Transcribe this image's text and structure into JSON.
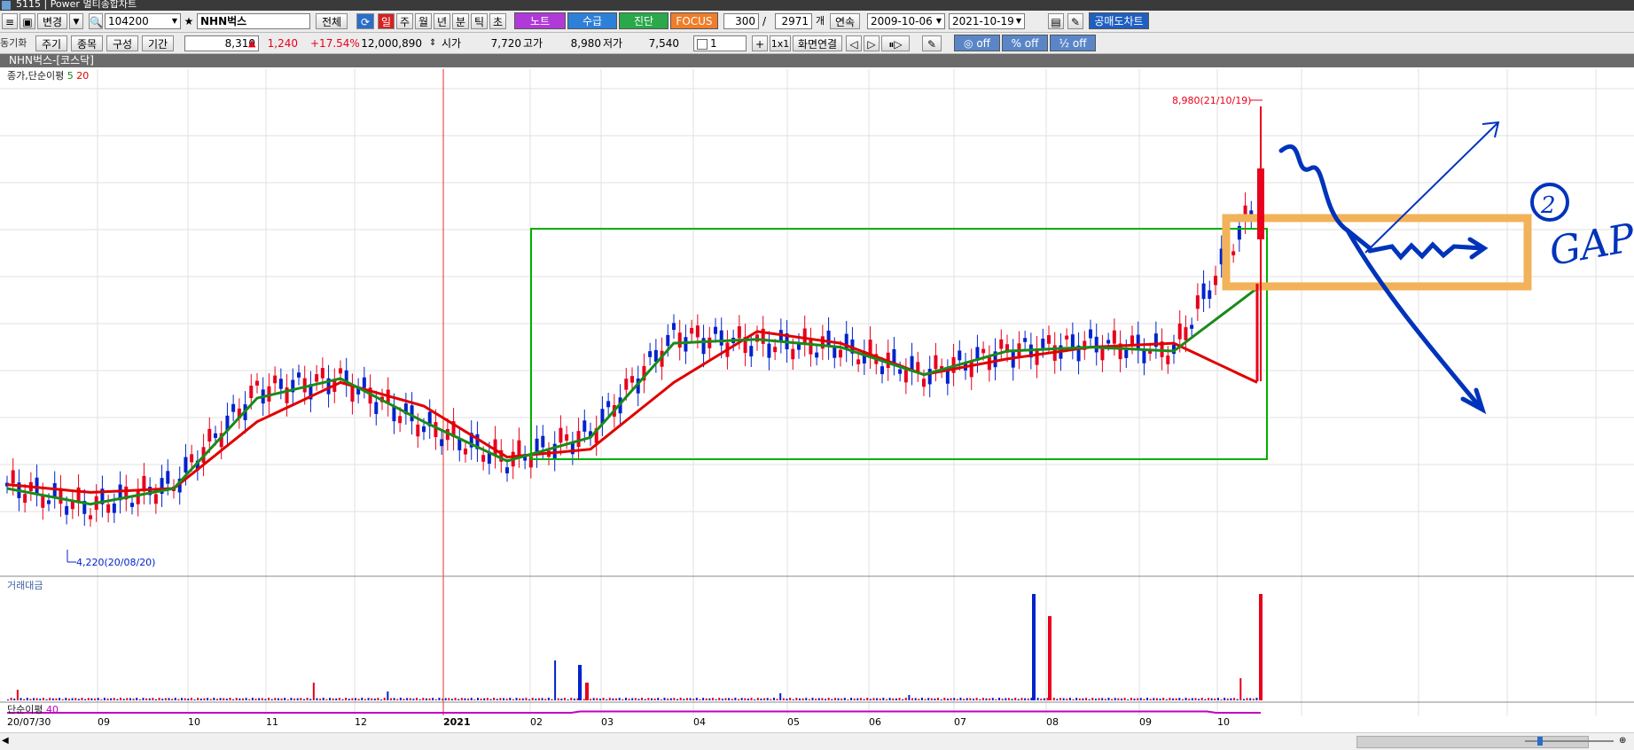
{
  "window": {
    "title": "5115 | Power 멀티종합차트"
  },
  "toolbar1": {
    "change_label": "변경",
    "code": "104200",
    "name": "NHN벅스",
    "all_label": "전체",
    "periods": [
      "일",
      "주",
      "월",
      "년",
      "분",
      "틱",
      "초"
    ],
    "note_label": "노트",
    "supply_label": "수급",
    "diag_label": "진단",
    "focus_label": "FOCUS",
    "count": "300",
    "total": "2971",
    "unit_label": "개",
    "continuous_label": "연속",
    "start_date": "2009-10-06",
    "end_date": "2021-10-19",
    "short_sell_label": "공매도차트"
  },
  "toolbar2": {
    "sync_label": "동기화",
    "period_label": "주기",
    "item_label": "종목",
    "compose_label": "구성",
    "range_label": "기간",
    "price": "8,310",
    "change": "1,240",
    "change_pct": "+17.54%",
    "volume": "12,000,890",
    "open_label": "시가",
    "open": "7,720",
    "high_label": "고가",
    "high": "8,980",
    "low_label": "저가",
    "low": "7,540",
    "spin_value": "1",
    "ratio_label": "1x1",
    "link_label": "화면연결",
    "off1": "off",
    "off2": "off",
    "off3": "off"
  },
  "chart_header": "NHN벅스-[코스닥]",
  "price_panel": {
    "label": "종가,단순이평",
    "ma5": "5",
    "ma20": "20",
    "high_annotation": "8,980(21/10/19)",
    "low_annotation": "4,220(20/08/20)"
  },
  "volume_panel": {
    "label": "거래대금"
  },
  "ma_panel": {
    "label": "단순이평",
    "period": "40"
  },
  "annotation": {
    "gap_text": "GAP",
    "circled_num": "2"
  },
  "x_axis": [
    "20/07/30",
    "09",
    "10",
    "11",
    "12",
    "2021",
    "02",
    "03",
    "04",
    "05",
    "06",
    "07",
    "08",
    "09",
    "10"
  ],
  "colors": {
    "up": "#e8001c",
    "down": "#0022cc",
    "ma5": "#1a8a1a",
    "ma20": "#e00000",
    "box": "#00b000",
    "highlight": "#f2b25a",
    "pen": "#0033bb",
    "ma40": "#c000c0"
  },
  "chart_data": {
    "type": "line",
    "title": "NHN벅스-[코스닥]",
    "x": [
      "2020-07-30",
      "2020-08-20",
      "2020-09",
      "2020-10",
      "2020-11",
      "2020-12",
      "2021-01",
      "2021-02",
      "2021-03",
      "2021-04",
      "2021-05",
      "2021-06",
      "2021-07",
      "2021-08",
      "2021-09",
      "2021-10-19"
    ],
    "series": [
      {
        "name": "종가",
        "values": [
          4700,
          4400,
          4700,
          5900,
          6050,
          5450,
          5000,
          5350,
          6600,
          6500,
          6450,
          6100,
          6400,
          6500,
          6400,
          8310
        ]
      },
      {
        "name": "5",
        "values": [
          4650,
          4450,
          4650,
          5800,
          6050,
          5500,
          5000,
          5300,
          6500,
          6550,
          6450,
          6100,
          6400,
          6450,
          6400,
          7200
        ]
      },
      {
        "name": "20",
        "values": [
          4700,
          4600,
          4650,
          5500,
          6000,
          5700,
          5050,
          5150,
          6000,
          6650,
          6500,
          6100,
          6300,
          6450,
          6500,
          6000
        ]
      }
    ],
    "annotations": [
      "8,980(21/10/19)",
      "4,220(20/08/20)"
    ],
    "grid": true
  }
}
